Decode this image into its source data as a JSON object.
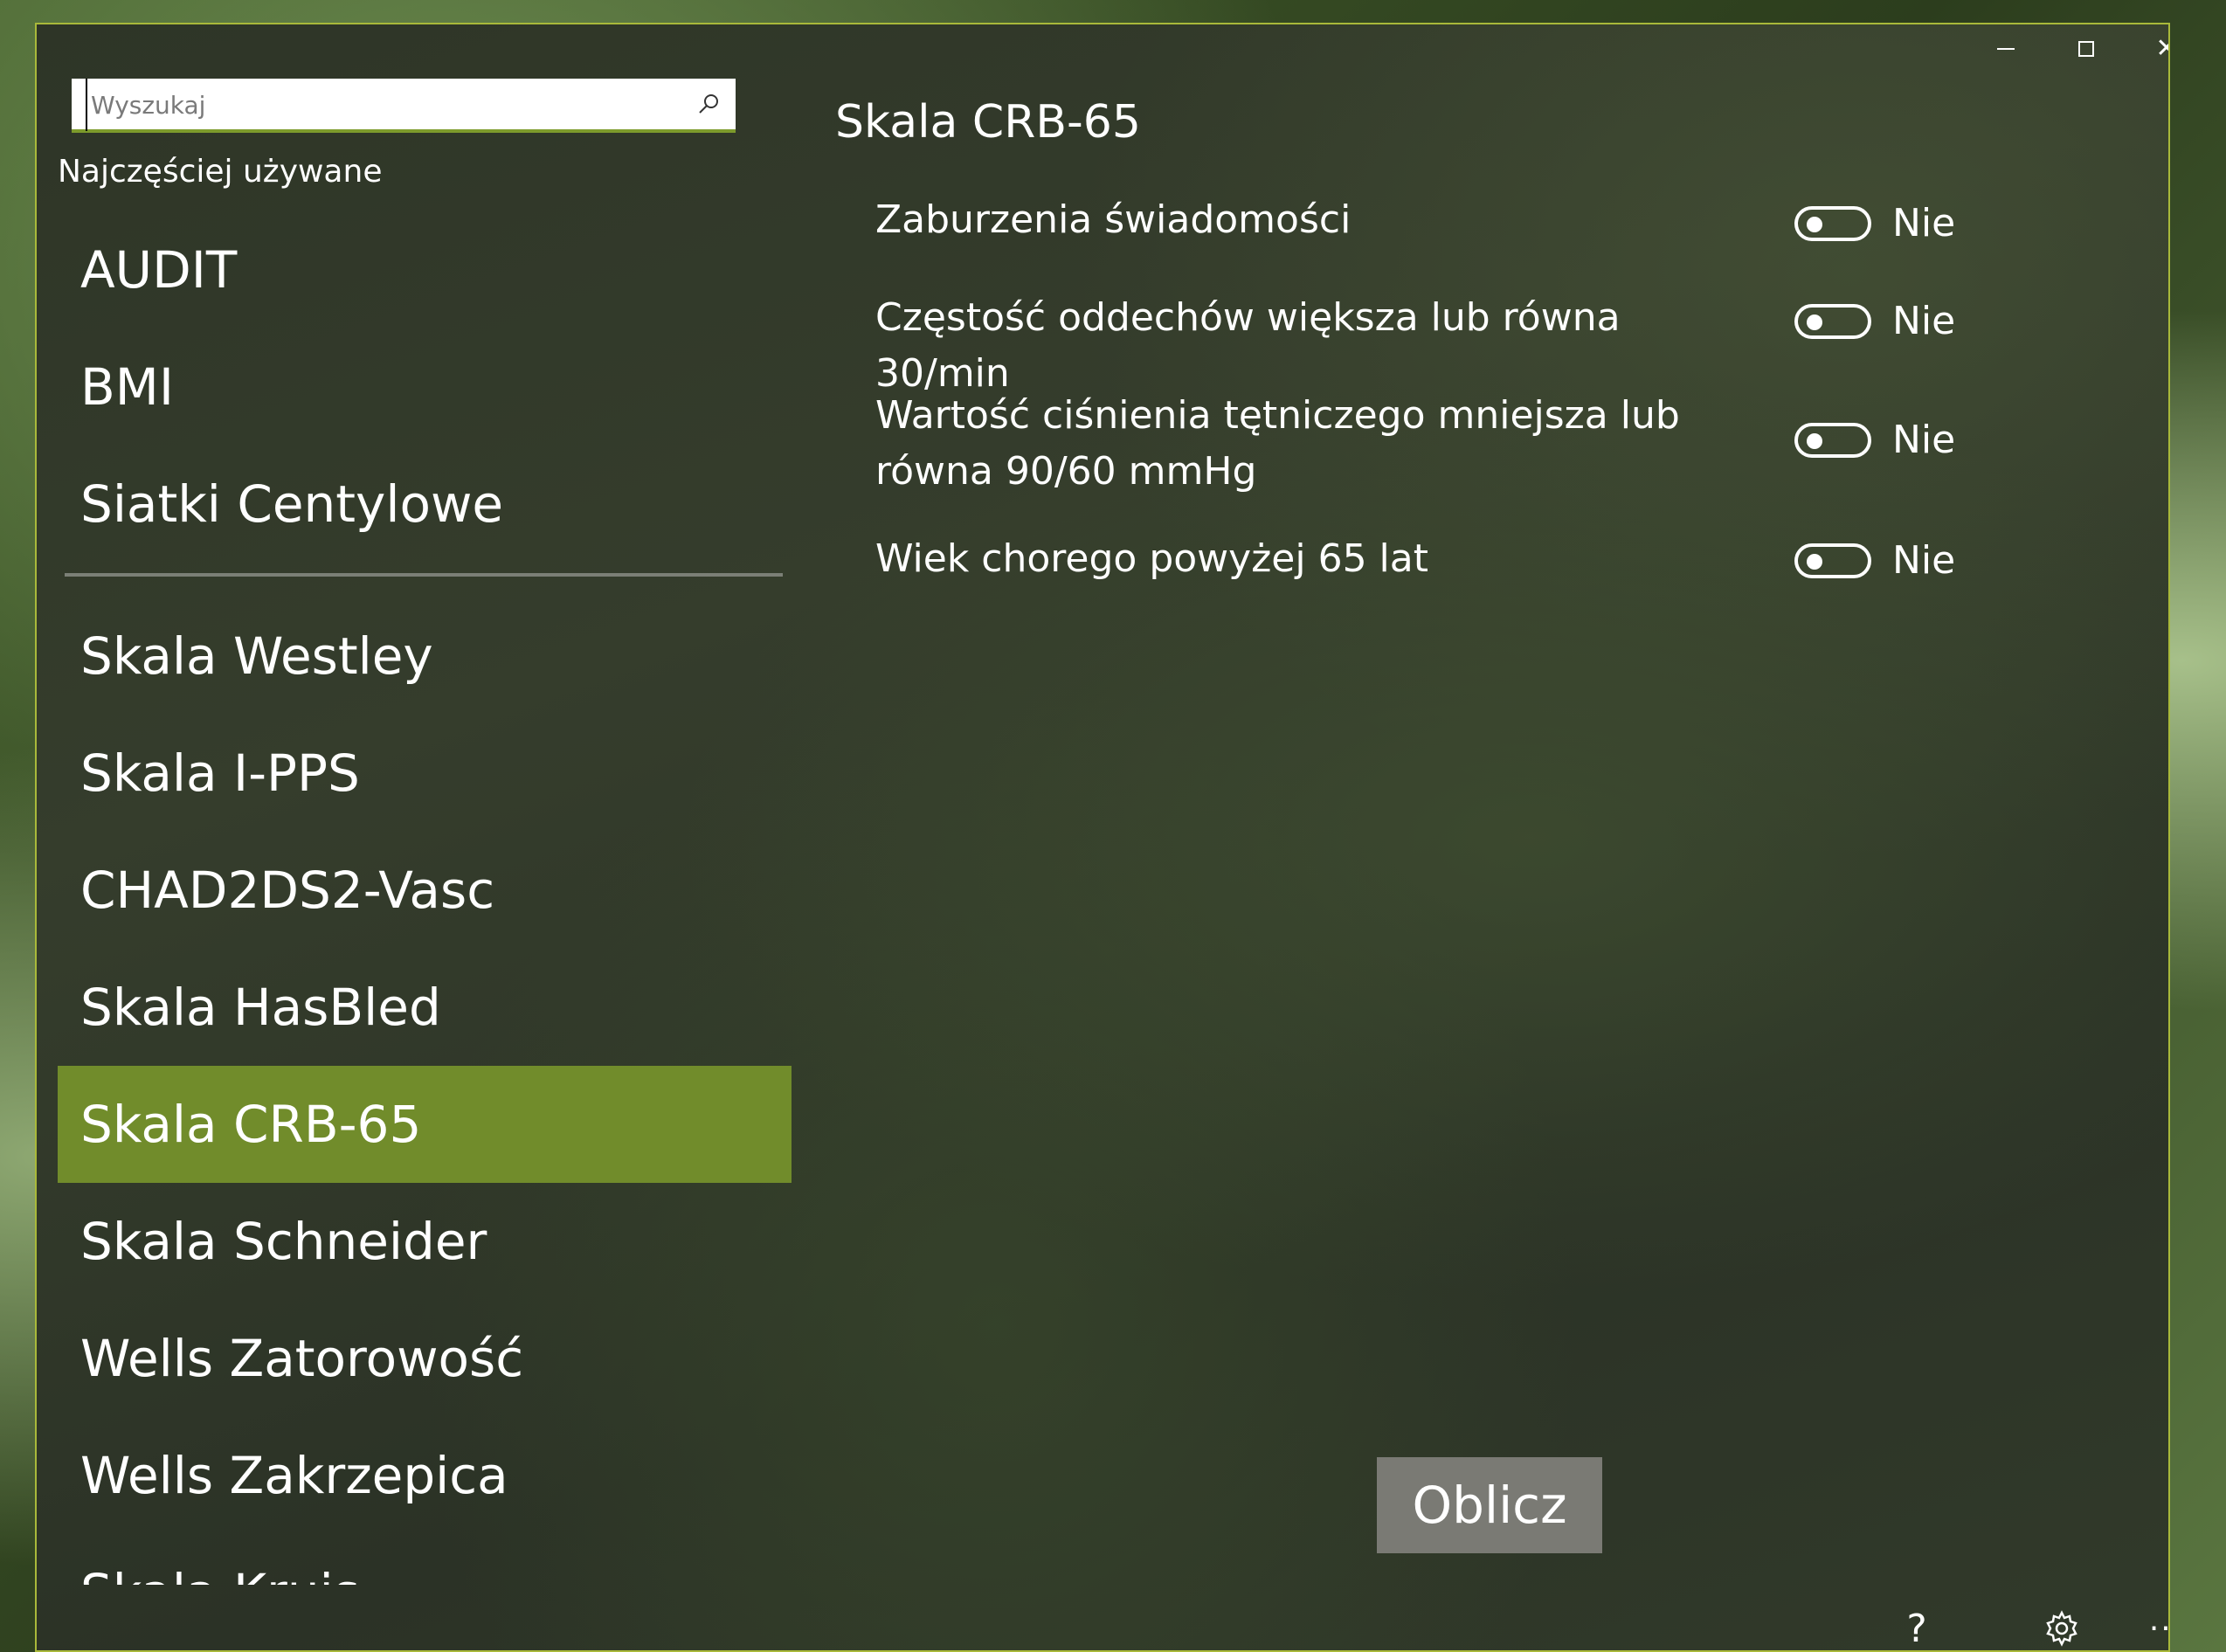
{
  "window": {
    "minimize_label": "—",
    "maximize_label": "□",
    "close_label": "✕"
  },
  "search": {
    "placeholder": "Wyszukaj",
    "icon": "search-icon"
  },
  "sidebar": {
    "section_label": "Najczęściej używane",
    "frequent_items": [
      {
        "label": "AUDIT"
      },
      {
        "label": "BMI"
      },
      {
        "label": "Siatki Centylowe"
      }
    ],
    "items": [
      {
        "label": "Skala Westley",
        "selected": false
      },
      {
        "label": "Skala I-PPS",
        "selected": false
      },
      {
        "label": "CHAD2DS2-Vasc",
        "selected": false
      },
      {
        "label": "Skala HasBled",
        "selected": false
      },
      {
        "label": "Skala CRB-65",
        "selected": true
      },
      {
        "label": "Skala Schneider",
        "selected": false
      },
      {
        "label": "Wells Zatorowość",
        "selected": false
      },
      {
        "label": "Wells Zakrzepica",
        "selected": false
      },
      {
        "label": "Skala Kruis",
        "selected": false
      }
    ],
    "accent_color": "#718c2b"
  },
  "main": {
    "title": "Skala CRB-65",
    "criteria": [
      {
        "label": "Zaburzenia świadomości",
        "state": "Nie"
      },
      {
        "label": "Częstość oddechów większa lub równa 30/min",
        "state": "Nie"
      },
      {
        "label": "Wartość ciśnienia tętniczego mniejsza lub równa 90/60 mmHg",
        "state": "Nie"
      },
      {
        "label": "Wiek chorego powyżej 65 lat",
        "state": "Nie"
      }
    ],
    "calculate_label": "Oblicz"
  },
  "footer": {
    "help_label": "?",
    "settings_icon": "gear-icon",
    "more_label": "···"
  }
}
